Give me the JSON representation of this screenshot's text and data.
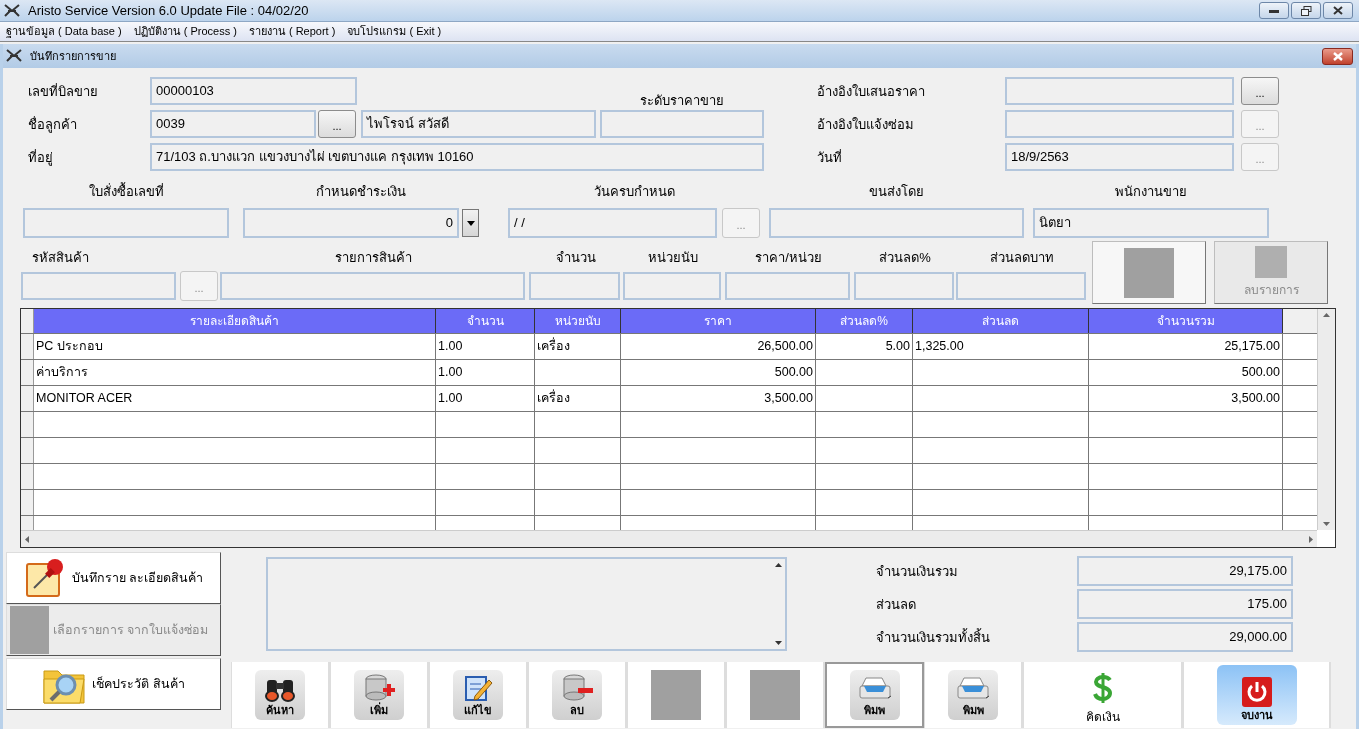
{
  "window": {
    "title": "Aristo Service Version 6.0 Update File : 04/02/20"
  },
  "menu": [
    {
      "label": "ฐานข้อมูล ( Data base )"
    },
    {
      "label": "ปฏิบัติงาน ( Process )"
    },
    {
      "label": "รายงาน ( Report )"
    },
    {
      "label": "จบโปรแกรม ( Exit )"
    }
  ],
  "form": {
    "title": "บันทึกรายการขาย"
  },
  "header": {
    "bill_no": {
      "label": "เลขที่บิลขาย",
      "value": "00000103"
    },
    "price_level": {
      "label": "ระดับราคาขาย"
    },
    "customer": {
      "label": "ชื่อลูกค้า",
      "code": "0039",
      "lookup": "...",
      "lookup_disabled": false,
      "name": "ไพโรจน์ สวัสดี"
    },
    "address": {
      "label": "ที่อยู่",
      "value": "71/103 ถ.บางแวก แขวงบางไผ่ เขตบางแค กรุงเทพ 10160"
    },
    "refs": [
      {
        "label": "อ้างอิงใบเสนอราคา",
        "lookup": "...",
        "lookup_disabled": false
      },
      {
        "label": "อ้างอิงใบแจ้งซ่อม",
        "lookup": "...",
        "lookup_disabled": true
      },
      {
        "label": "วันที่",
        "value": "18/9/2563",
        "lookup": "...",
        "lookup_disabled": true
      }
    ]
  },
  "order": {
    "po_no": {
      "label": "ใบสั่งซื้อเลขที่"
    },
    "payment_terms": {
      "label": "กำหนดชำระเงิน",
      "value": "0"
    },
    "due_date": {
      "label": "วันครบกำหนด",
      "value": "/  /",
      "lookup": "...",
      "lookup_disabled": true
    },
    "shipped_by": {
      "label": "ขนส่งโดย"
    },
    "salesperson": {
      "label": "พนักงานขาย",
      "value": "นิตยา"
    }
  },
  "item_entry": {
    "code": {
      "label": "รหัสสินค้า",
      "lookup": "...",
      "lookup_disabled": true
    },
    "fields": [
      {
        "label": "รายการสินค้า"
      },
      {
        "label": "จำนวน"
      },
      {
        "label": "หน่วยนับ"
      },
      {
        "label": "ราคา/หน่วย"
      },
      {
        "label": "ส่วนลด%"
      },
      {
        "label": "ส่วนลดบาท"
      }
    ],
    "buttons": [
      {
        "disabled": false
      },
      {
        "label": "ลบรายการ",
        "disabled": true
      }
    ]
  },
  "table": {
    "columns": [
      "รายละเอียดสินค้า",
      "จำนวน",
      "หน่วยนับ",
      "ราคา",
      "ส่วนลด%",
      "ส่วนลด",
      "จำนวนรวม"
    ],
    "rows": [
      [
        "PC ประกอบ",
        "1.00",
        "เครื่อง",
        "26,500.00",
        "5.00",
        "1,325.00",
        "25,175.00"
      ],
      [
        "ค่าบริการ",
        "1.00",
        null,
        "500.00",
        null,
        null,
        "500.00"
      ],
      [
        "MONITOR ACER",
        "1.00",
        "เครื่อง",
        "3,500.00",
        null,
        null,
        "3,500.00"
      ]
    ]
  },
  "side_buttons": [
    {
      "label": "บันทึกราย ละเอียดสินค้า",
      "kind": "pin",
      "disabled": false
    },
    {
      "label": "เลือกรายการ จากใบแจ้งซ่อม",
      "kind": "blank",
      "disabled": true
    },
    {
      "label": "เช็คประวัติ สินค้า",
      "kind": "folder",
      "disabled": false
    }
  ],
  "totals": [
    {
      "label": "จำนวนเงินรวม",
      "value": "29,175.00"
    },
    {
      "label": "ส่วนลด",
      "value": "175.00"
    },
    {
      "label": "จำนวนเงินรวมทั้งสิ้น",
      "value": "29,000.00"
    }
  ],
  "toolbar": [
    {
      "label": "ค้นหา",
      "kind": "binoculars",
      "focused": false,
      "highlighted": false
    },
    {
      "label": "เพิ่ม",
      "kind": "db-add",
      "focused": false,
      "highlighted": false
    },
    {
      "label": "แก้ไข",
      "kind": "edit",
      "focused": false,
      "highlighted": false
    },
    {
      "label": "ลบ",
      "kind": "db-remove",
      "focused": false,
      "highlighted": false
    },
    {
      "kind": "blank",
      "focused": false,
      "highlighted": false
    },
    {
      "kind": "blank",
      "focused": false,
      "highlighted": false
    },
    {
      "label": "พิมพ",
      "kind": "printer",
      "focused": true,
      "highlighted": false
    },
    {
      "label": "พิมพ",
      "kind": "printer",
      "focused": false,
      "highlighted": false
    },
    {
      "label": "คิดเงิน",
      "kind": "dollar",
      "focused": false,
      "highlighted": false
    },
    {
      "label": "จบงาน",
      "kind": "power",
      "focused": false,
      "highlighted": true
    }
  ]
}
